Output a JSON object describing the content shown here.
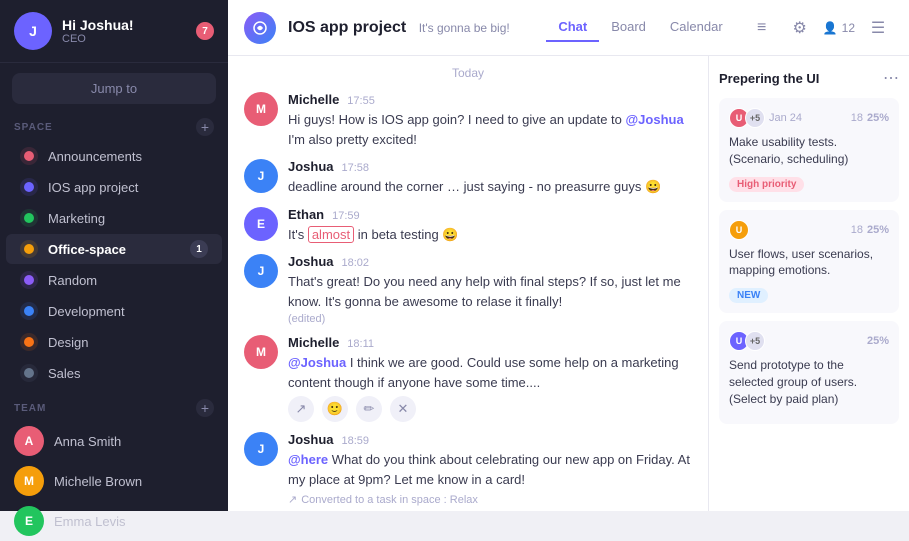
{
  "sidebar": {
    "header": {
      "greeting": "Hi Joshua!",
      "role": "CEO",
      "notif_count": "7"
    },
    "jump_to_label": "Jump to",
    "spaces_label": "SPACE",
    "teams_label": "TEAM",
    "spaces": [
      {
        "id": "announcements",
        "label": "Announcements",
        "color": "#e85d75",
        "icon": "🔴"
      },
      {
        "id": "ios-app",
        "label": "IOS app project",
        "color": "#6c63ff",
        "icon": "🔵"
      },
      {
        "id": "marketing",
        "label": "Marketing",
        "color": "#22c55e",
        "icon": "🟢"
      },
      {
        "id": "office-space",
        "label": "Office-space",
        "color": "#f59e0b",
        "icon": "🟡",
        "badge": "1",
        "active": true
      },
      {
        "id": "random",
        "label": "Random",
        "color": "#8b5cf6",
        "icon": "🟣"
      },
      {
        "id": "development",
        "label": "Development",
        "color": "#3b82f6",
        "icon": "🔵"
      },
      {
        "id": "design",
        "label": "Design",
        "color": "#f97316",
        "icon": "🟠"
      },
      {
        "id": "sales",
        "label": "Sales",
        "color": "#64748b",
        "icon": "⚫"
      }
    ],
    "team_members": [
      {
        "id": "anna",
        "label": "Anna Smith",
        "color": "#e85d75",
        "initials": "A"
      },
      {
        "id": "michelle",
        "label": "Michelle Brown",
        "color": "#f59e0b",
        "initials": "M"
      },
      {
        "id": "emma",
        "label": "Emma Levis",
        "color": "#22c55e",
        "initials": "E"
      }
    ]
  },
  "topbar": {
    "title": "IOS app project",
    "subtitle": "It's gonna be big!",
    "tabs": [
      {
        "id": "chat",
        "label": "Chat",
        "active": true
      },
      {
        "id": "board",
        "label": "Board"
      },
      {
        "id": "calendar",
        "label": "Calendar"
      }
    ],
    "member_count": "12",
    "icons": {
      "menu": "≡",
      "settings": "⚙",
      "members": "👤",
      "more": "☰"
    }
  },
  "chat": {
    "date_label": "Today",
    "messages": [
      {
        "id": 1,
        "name": "Michelle",
        "time": "17:55",
        "text_parts": [
          {
            "type": "text",
            "value": "Hi guys! How is IOS app goin? I need to give an update to "
          },
          {
            "type": "mention",
            "value": "@Joshua"
          },
          {
            "type": "text",
            "value": "\nI'm also pretty excited!"
          }
        ],
        "avatar_color": "#e85d75",
        "initials": "M"
      },
      {
        "id": 2,
        "name": "Joshua",
        "time": "17:58",
        "text": "deadline around the corner … just saying - no preasurre guys 😀",
        "avatar_color": "#3b82f6",
        "initials": "J"
      },
      {
        "id": 3,
        "name": "Ethan",
        "time": "17:59",
        "text_parts": [
          {
            "type": "text",
            "value": "It's "
          },
          {
            "type": "highlight",
            "value": "almost"
          },
          {
            "type": "text",
            "value": " in beta testing 😀"
          }
        ],
        "avatar_color": "#6c63ff",
        "initials": "E"
      },
      {
        "id": 4,
        "name": "Joshua",
        "time": "18:02",
        "text": "That's great! Do you need any help with final steps? If so, just let me know. It's gonna be awesome to relase it finally!",
        "edited": "(edited)",
        "avatar_color": "#3b82f6",
        "initials": "J"
      },
      {
        "id": 5,
        "name": "Michelle",
        "time": "18:11",
        "text_parts": [
          {
            "type": "mention",
            "value": "@Joshua"
          },
          {
            "type": "text",
            "value": " I think we are good. Could use some help on a marketing content though if anyone have some time...."
          }
        ],
        "avatar_color": "#e85d75",
        "initials": "M",
        "has_actions": true
      },
      {
        "id": 6,
        "name": "Joshua",
        "time": "18:59",
        "text_parts": [
          {
            "type": "mention",
            "value": "@here"
          },
          {
            "type": "text",
            "value": " What do you think about celebrating our new app on Friday. At my place at 9pm? Let me know in a card!"
          }
        ],
        "converted": "Converted to a task in space : Relax",
        "avatar_color": "#3b82f6",
        "initials": "J"
      }
    ]
  },
  "right_panel": {
    "title": "Prepering the UI",
    "tasks": [
      {
        "id": 1,
        "date": "Jan 24",
        "assignees_extra": "+5",
        "count": "18",
        "pct": "25%",
        "text": "Make usability tests. (Scenario, scheduling)",
        "tag": "High priority",
        "tag_type": "high"
      },
      {
        "id": 2,
        "count": "18",
        "pct": "25%",
        "text": "User flows, user scenarios, mapping emotions.",
        "tag": "NEW",
        "tag_type": "new"
      },
      {
        "id": 3,
        "assignees_extra": "+5",
        "pct": "25%",
        "text": "Send prototype to the selected group of users. (Select by paid plan)"
      }
    ]
  }
}
